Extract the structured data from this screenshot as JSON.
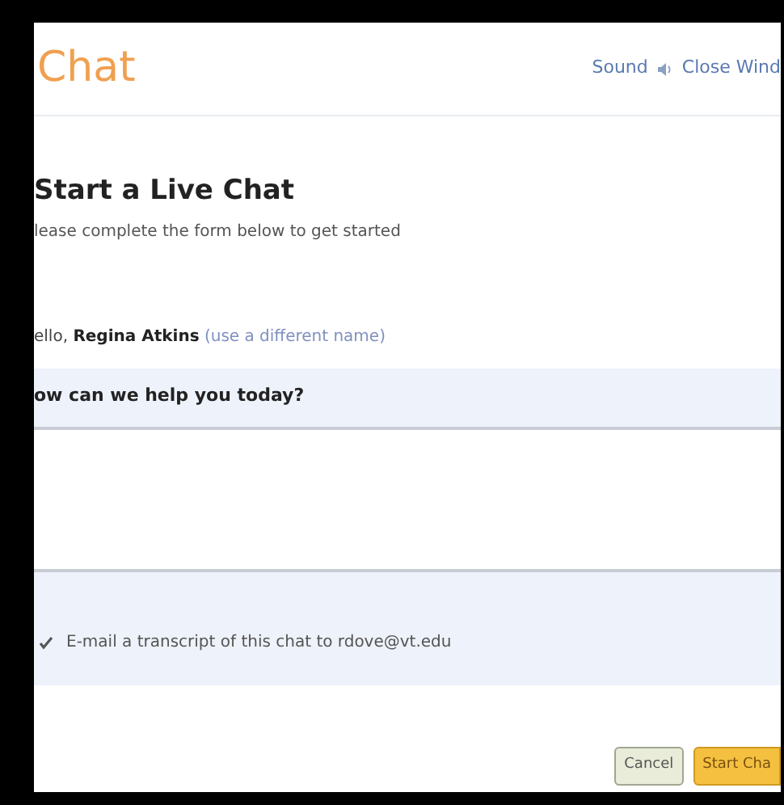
{
  "header": {
    "title": "Chat",
    "links": [
      {
        "label": "Sound",
        "kind": "sound"
      },
      {
        "label": "Close Wind",
        "kind": "plain"
      }
    ]
  },
  "heading": "Start a Live Chat",
  "subtitle": "lease complete the form below to get started",
  "greeting": {
    "prefix": "ello, ",
    "name": "Regina Atkins",
    "link": "(use a different name)"
  },
  "question": {
    "label": "ow can we help you today?"
  },
  "transcript": {
    "checked": true,
    "label": "E-mail a transcript of this chat to rdove@vt.edu"
  },
  "buttons": [
    {
      "label": "Cancel",
      "kind": "secondary"
    },
    {
      "label": "Start Cha",
      "kind": "primary"
    }
  ]
}
